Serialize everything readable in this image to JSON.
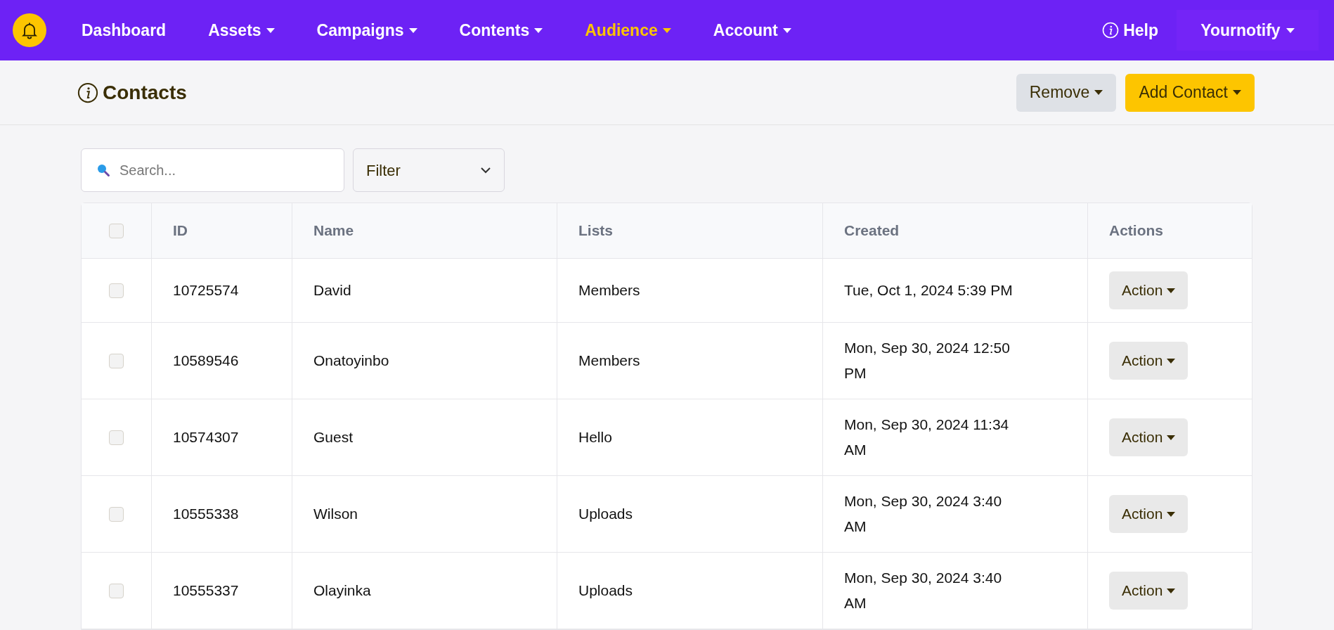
{
  "nav": {
    "items": [
      {
        "label": "Dashboard",
        "dropdown": false,
        "selected": false
      },
      {
        "label": "Assets",
        "dropdown": true,
        "selected": false
      },
      {
        "label": "Campaigns",
        "dropdown": true,
        "selected": false
      },
      {
        "label": "Contents",
        "dropdown": true,
        "selected": false
      },
      {
        "label": "Audience",
        "dropdown": true,
        "selected": true
      },
      {
        "label": "Account",
        "dropdown": true,
        "selected": false
      }
    ],
    "help": "Help",
    "account_menu": "Yournotify"
  },
  "page": {
    "title": "Contacts",
    "buttons": [
      {
        "label": "Remove",
        "kind": "secondary"
      },
      {
        "label": "Add Contact",
        "kind": "primary"
      }
    ]
  },
  "search": {
    "placeholder": "Search..."
  },
  "filter": {
    "value": "Filter"
  },
  "table": {
    "select_all": {
      "checked": false
    },
    "columns": [
      "ID",
      "Name",
      "Lists",
      "Created",
      "Actions"
    ],
    "rows": [
      {
        "checked": false,
        "id": "10725574",
        "name": "David",
        "list": "Members",
        "created": "Tue, Oct 1, 2024 5:39 PM",
        "action": "Action"
      },
      {
        "checked": false,
        "id": "10589546",
        "name": "Onatoyinbo",
        "list": "Members",
        "created": "Mon, Sep 30, 2024 12:50 PM",
        "action": "Action"
      },
      {
        "checked": false,
        "id": "10574307",
        "name": "Guest",
        "list": "Hello",
        "created": "Mon, Sep 30, 2024 11:34 AM",
        "action": "Action"
      },
      {
        "checked": false,
        "id": "10555338",
        "name": "Wilson",
        "list": "Uploads",
        "created": "Mon, Sep 30, 2024 3:40 AM",
        "action": "Action"
      },
      {
        "checked": false,
        "id": "10555337",
        "name": "Olayinka",
        "list": "Uploads",
        "created": "Mon, Sep 30, 2024 3:40 AM",
        "action": "Action"
      }
    ]
  }
}
